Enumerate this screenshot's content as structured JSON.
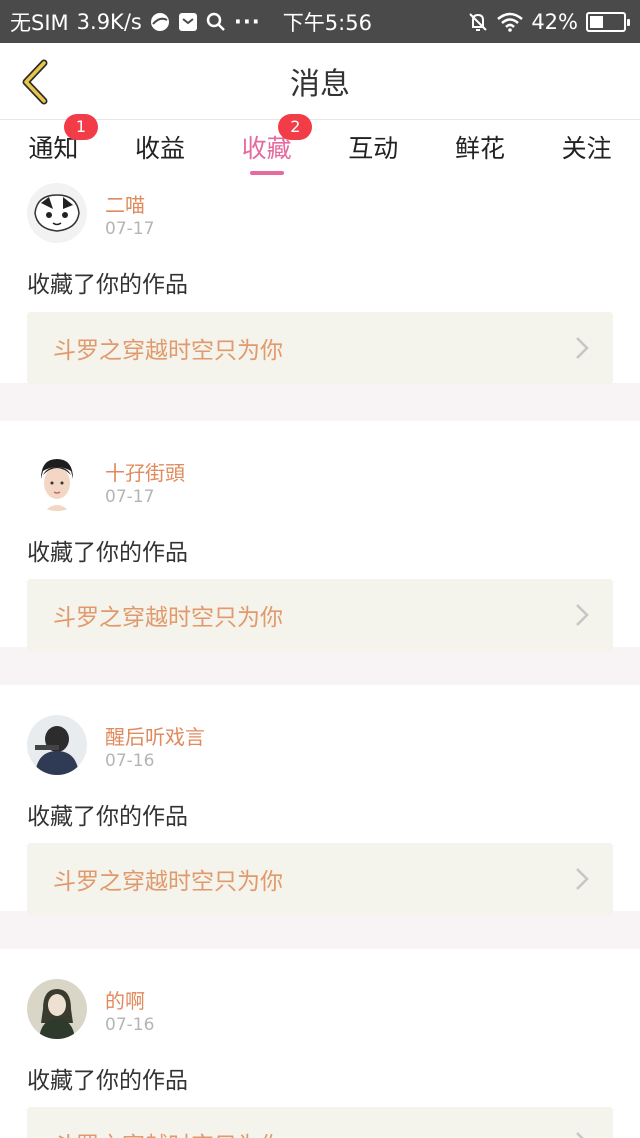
{
  "status_bar": {
    "carrier": "无SIM",
    "speed": "3.9K/s",
    "dots": "···",
    "time": "下午5:56",
    "battery": "42%",
    "battery_level": 0.42
  },
  "header": {
    "title": "消息",
    "back_icon": "chevron-left-icon"
  },
  "tabs": [
    {
      "label": "通知",
      "badge": "1",
      "active": false
    },
    {
      "label": "收益",
      "badge": "",
      "active": false
    },
    {
      "label": "收藏",
      "badge": "2",
      "active": true
    },
    {
      "label": "互动",
      "badge": "",
      "active": false
    },
    {
      "label": "鲜花",
      "badge": "",
      "active": false
    },
    {
      "label": "关注",
      "badge": "",
      "active": false
    }
  ],
  "items": [
    {
      "name": "二喵",
      "date": "07-17",
      "action": "收藏了你的作品",
      "work": "斗罗之穿越时空只为你"
    },
    {
      "name": "十孖街頭",
      "date": "07-17",
      "action": "收藏了你的作品",
      "work": "斗罗之穿越时空只为你"
    },
    {
      "name": "醒后听戏言",
      "date": "07-16",
      "action": "收藏了你的作品",
      "work": "斗罗之穿越时空只为你"
    },
    {
      "name": "的啊",
      "date": "07-16",
      "action": "收藏了你的作品",
      "work": "斗罗之穿越时空只为你"
    }
  ],
  "colors": {
    "accent": "#e56b9e",
    "badge": "#f23d49",
    "name": "#e08a5d",
    "work": "#e09a6b",
    "back_icon": "#c9a21a"
  }
}
